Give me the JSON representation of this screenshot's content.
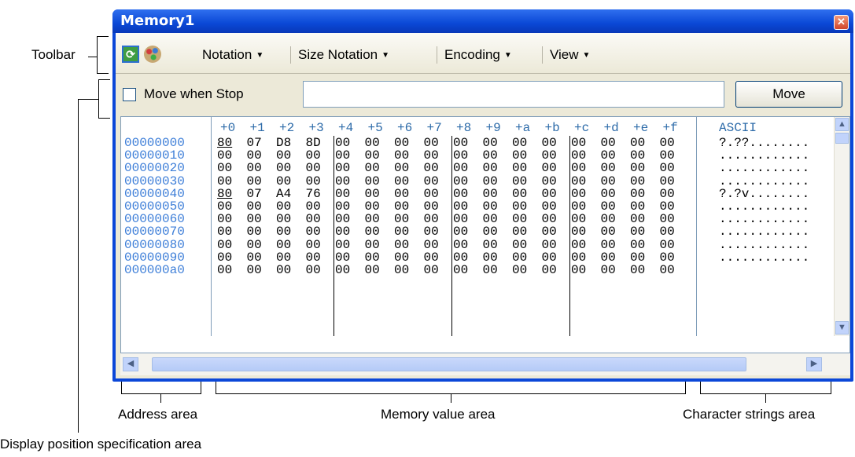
{
  "window": {
    "title": "Memory1",
    "close_icon": "close-icon"
  },
  "toolbar": {
    "refresh_icon": "refresh-icon",
    "palette_icon": "palette-icon",
    "menus": [
      "Notation",
      "Size Notation",
      "Encoding",
      "View"
    ]
  },
  "position_bar": {
    "checkbox_label": "Move when Stop",
    "checked": false,
    "input_value": "",
    "move_label": "Move"
  },
  "grid": {
    "column_headers": [
      "+0",
      "+1",
      "+2",
      "+3",
      "+4",
      "+5",
      "+6",
      "+7",
      "+8",
      "+9",
      "+a",
      "+b",
      "+c",
      "+d",
      "+e",
      "+f"
    ],
    "ascii_header": "ASCII",
    "rows": [
      {
        "address": "00000000",
        "values": [
          "80",
          "07",
          "D8",
          "8D",
          "00",
          "00",
          "00",
          "00",
          "00",
          "00",
          "00",
          "00",
          "00",
          "00",
          "00",
          "00"
        ],
        "ascii": "?.??........"
      },
      {
        "address": "00000010",
        "values": [
          "00",
          "00",
          "00",
          "00",
          "00",
          "00",
          "00",
          "00",
          "00",
          "00",
          "00",
          "00",
          "00",
          "00",
          "00",
          "00"
        ],
        "ascii": "............"
      },
      {
        "address": "00000020",
        "values": [
          "00",
          "00",
          "00",
          "00",
          "00",
          "00",
          "00",
          "00",
          "00",
          "00",
          "00",
          "00",
          "00",
          "00",
          "00",
          "00"
        ],
        "ascii": "............"
      },
      {
        "address": "00000030",
        "values": [
          "00",
          "00",
          "00",
          "00",
          "00",
          "00",
          "00",
          "00",
          "00",
          "00",
          "00",
          "00",
          "00",
          "00",
          "00",
          "00"
        ],
        "ascii": "............"
      },
      {
        "address": "00000040",
        "values": [
          "80",
          "07",
          "A4",
          "76",
          "00",
          "00",
          "00",
          "00",
          "00",
          "00",
          "00",
          "00",
          "00",
          "00",
          "00",
          "00"
        ],
        "ascii": "?.?v........"
      },
      {
        "address": "00000050",
        "values": [
          "00",
          "00",
          "00",
          "00",
          "00",
          "00",
          "00",
          "00",
          "00",
          "00",
          "00",
          "00",
          "00",
          "00",
          "00",
          "00"
        ],
        "ascii": "............"
      },
      {
        "address": "00000060",
        "values": [
          "00",
          "00",
          "00",
          "00",
          "00",
          "00",
          "00",
          "00",
          "00",
          "00",
          "00",
          "00",
          "00",
          "00",
          "00",
          "00"
        ],
        "ascii": "............"
      },
      {
        "address": "00000070",
        "values": [
          "00",
          "00",
          "00",
          "00",
          "00",
          "00",
          "00",
          "00",
          "00",
          "00",
          "00",
          "00",
          "00",
          "00",
          "00",
          "00"
        ],
        "ascii": "............"
      },
      {
        "address": "00000080",
        "values": [
          "00",
          "00",
          "00",
          "00",
          "00",
          "00",
          "00",
          "00",
          "00",
          "00",
          "00",
          "00",
          "00",
          "00",
          "00",
          "00"
        ],
        "ascii": "............"
      },
      {
        "address": "00000090",
        "values": [
          "00",
          "00",
          "00",
          "00",
          "00",
          "00",
          "00",
          "00",
          "00",
          "00",
          "00",
          "00",
          "00",
          "00",
          "00",
          "00"
        ],
        "ascii": "............"
      },
      {
        "address": "000000a0",
        "values": [
          "00",
          "00",
          "00",
          "00",
          "00",
          "00",
          "00",
          "00",
          "00",
          "00",
          "00",
          "00",
          "00",
          "00",
          "00",
          "00"
        ],
        "ascii": ""
      }
    ]
  },
  "scrollbars": {
    "up_icon": "arrow-up-icon",
    "down_icon": "arrow-down-icon",
    "left_icon": "arrow-left-icon",
    "right_icon": "arrow-right-icon"
  },
  "callouts": {
    "toolbar": "Toolbar",
    "address_area": "Address area",
    "memory_value_area": "Memory value area",
    "character_strings_area": "Character strings area",
    "display_position_area": "Display position specification area"
  }
}
